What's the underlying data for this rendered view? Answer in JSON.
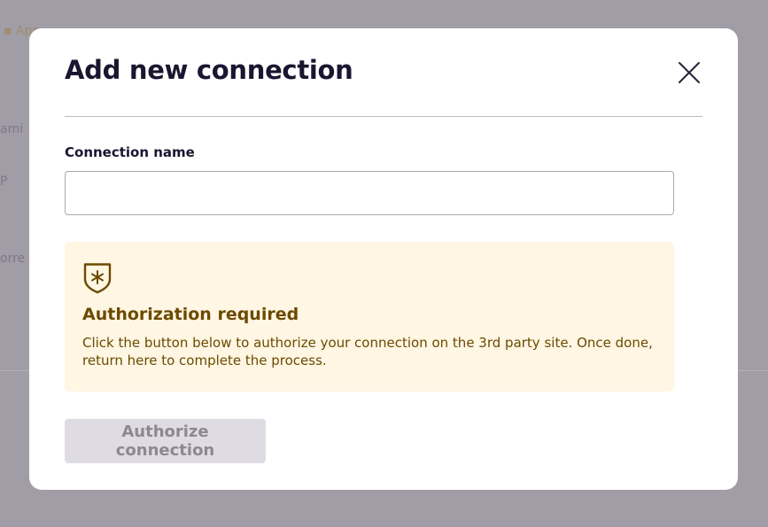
{
  "modal": {
    "title": "Add new connection",
    "close_icon": "close-icon",
    "connection_name": {
      "label": "Connection name",
      "value": "",
      "placeholder": ""
    },
    "alert": {
      "icon": "shield-star-icon",
      "title": "Authorization required",
      "body": "Click the button below to authorize your connection on the 3rd party site. Once done, return here to complete the process."
    },
    "authorize_button": {
      "label": "Authorize connection",
      "disabled": true
    }
  },
  "colors": {
    "backdrop": "#a19da6",
    "title_text": "#1c1530",
    "alert_background": "#fff6e3",
    "alert_text": "#6b4a00",
    "disabled_button_background": "#dedce2",
    "disabled_button_text": "#8c8893"
  }
}
